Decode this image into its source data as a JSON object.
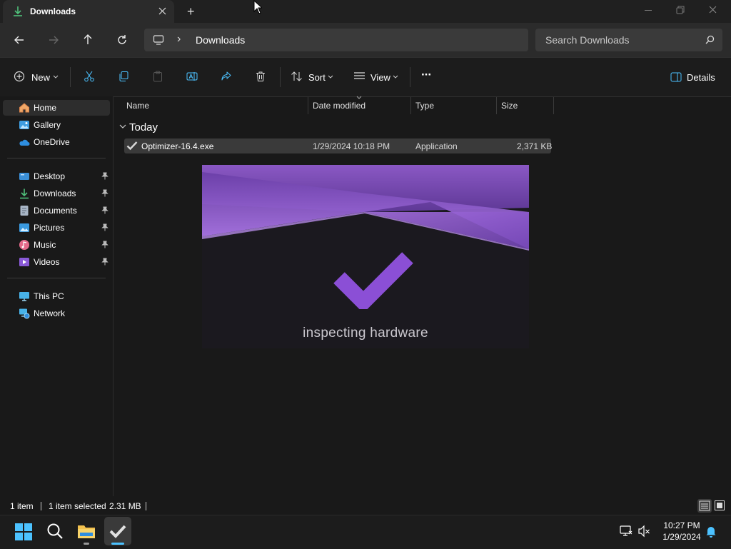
{
  "window": {
    "tab_title": "Downloads",
    "new_tab": "+"
  },
  "address": {
    "breadcrumb_sep": "›",
    "location": "Downloads",
    "search_placeholder": "Search Downloads"
  },
  "toolbar": {
    "new_label": "New",
    "sort_label": "Sort",
    "view_label": "View",
    "more_label": "···",
    "details_label": "Details"
  },
  "sidebar": {
    "home": "Home",
    "gallery": "Gallery",
    "onedrive": "OneDrive",
    "desktop": "Desktop",
    "downloads": "Downloads",
    "documents": "Documents",
    "pictures": "Pictures",
    "music": "Music",
    "videos": "Videos",
    "thispc": "This PC",
    "network": "Network"
  },
  "columns": {
    "name": "Name",
    "date": "Date modified",
    "type": "Type",
    "size": "Size"
  },
  "group": {
    "label": "Today"
  },
  "file": {
    "name": "Optimizer-16.4.exe",
    "date": "1/29/2024 10:18 PM",
    "type": "Application",
    "size": "2,371 KB"
  },
  "splash": {
    "text": "inspecting hardware"
  },
  "status": {
    "count": "1 item",
    "selected": "1 item selected",
    "size": "2.31 MB"
  },
  "taskbar": {
    "time": "10:27 PM",
    "date": "1/29/2024"
  },
  "colors": {
    "accent": "#4cc2ff",
    "purple": "#8b4fd6",
    "folder": "#f2c14e"
  }
}
